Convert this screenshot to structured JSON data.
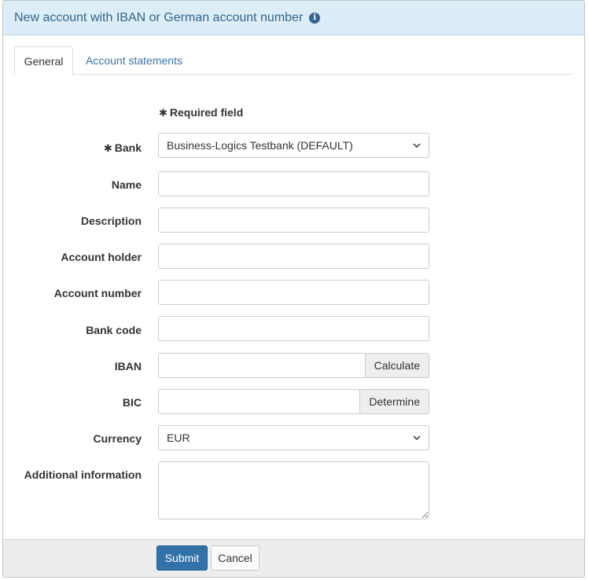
{
  "header": {
    "title": "New account with IBAN or German account number",
    "info_icon": "info-icon",
    "info_glyph": "i"
  },
  "tabs": [
    {
      "label": "General",
      "active": true
    },
    {
      "label": "Account statements",
      "active": false
    }
  ],
  "form": {
    "required_note": "Required field",
    "required_marker": "✱",
    "bank": {
      "label": "Bank",
      "value": "Business-Logics Testbank (DEFAULT)"
    },
    "name": {
      "label": "Name",
      "value": ""
    },
    "description": {
      "label": "Description",
      "value": ""
    },
    "account_holder": {
      "label": "Account holder",
      "value": ""
    },
    "account_number": {
      "label": "Account number",
      "value": ""
    },
    "bank_code": {
      "label": "Bank code",
      "value": ""
    },
    "iban": {
      "label": "IBAN",
      "value": "",
      "button": "Calculate"
    },
    "bic": {
      "label": "BIC",
      "value": "",
      "button": "Determine"
    },
    "currency": {
      "label": "Currency",
      "value": "EUR"
    },
    "additional_information": {
      "label": "Additional information",
      "value": ""
    }
  },
  "footer": {
    "submit_label": "Submit",
    "cancel_label": "Cancel"
  },
  "colors": {
    "header_bg": "#dcedf7",
    "title": "#34668e",
    "link": "#3a74a5",
    "primary_button": "#3172a8"
  }
}
